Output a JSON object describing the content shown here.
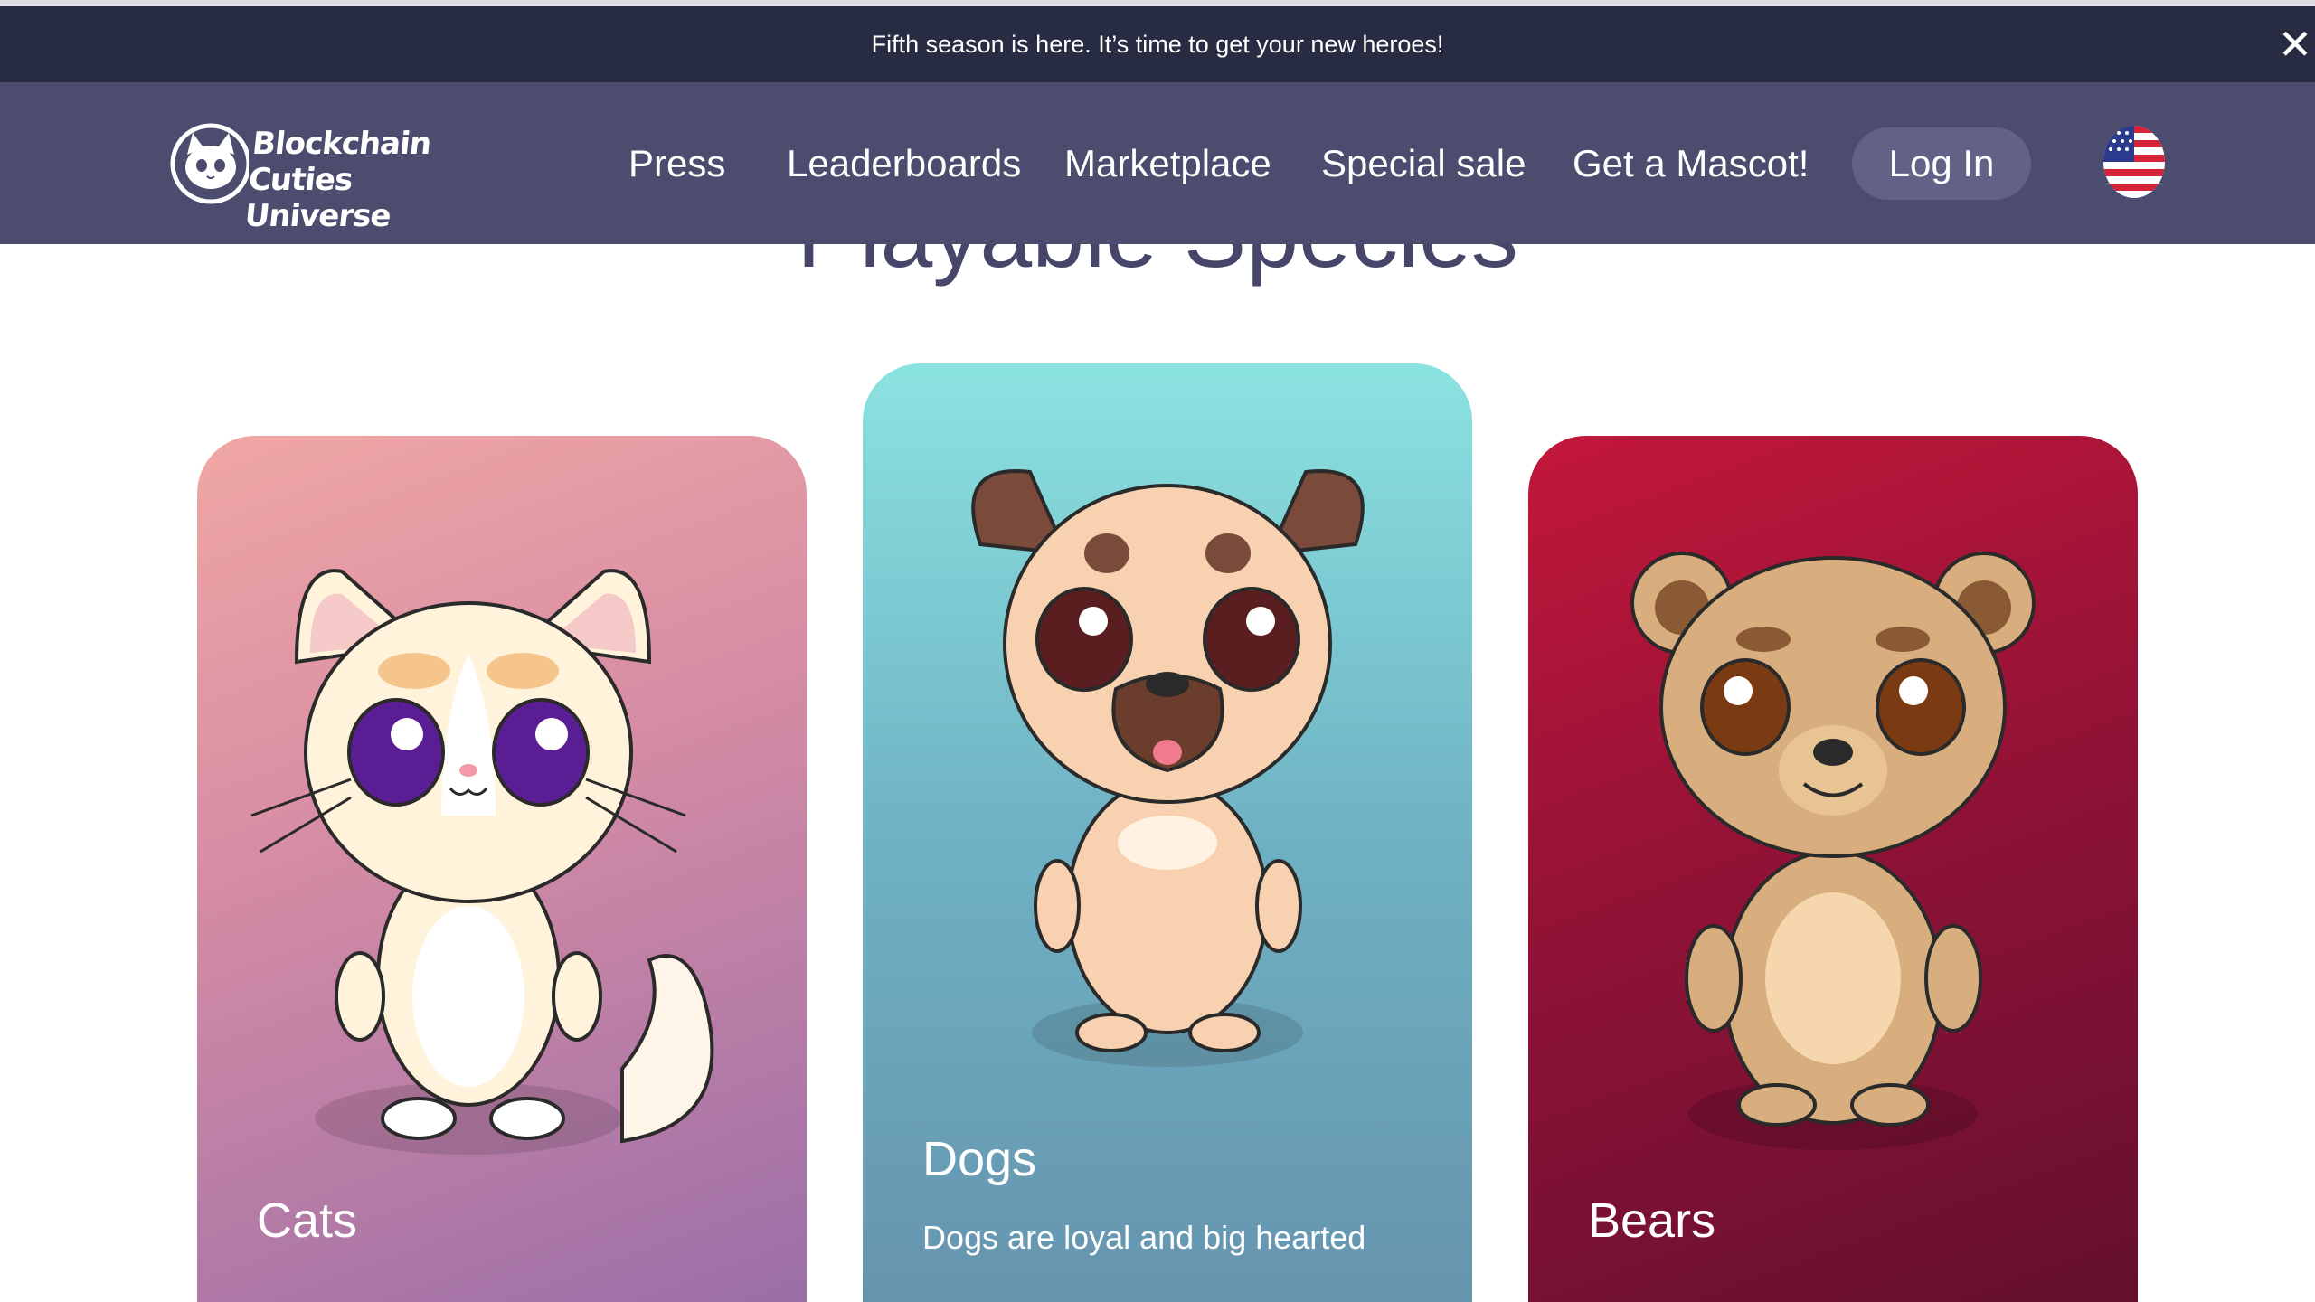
{
  "announcement": {
    "text": "Fifth season is here. It’s time to get your new heroes!",
    "close_glyph": "✕"
  },
  "header": {
    "logo": {
      "line1": "Blockchain",
      "line2": "Cuties Universe",
      "icon": "cat-face-icon"
    },
    "nav": [
      {
        "label": "Press"
      },
      {
        "label": "Leaderboards"
      },
      {
        "label": "Marketplace"
      },
      {
        "label": "Special sale"
      },
      {
        "label": "Get a Mascot!"
      }
    ],
    "login_label": "Log In",
    "language_flag": "us-flag-icon"
  },
  "section": {
    "title": "Playable Species"
  },
  "cards": [
    {
      "name": "Cats",
      "description": "",
      "icon": "cat-character-icon"
    },
    {
      "name": "Dogs",
      "description": "Dogs are loyal and big hearted",
      "icon": "dog-character-icon"
    },
    {
      "name": "Bears",
      "description": "",
      "icon": "bear-character-icon"
    }
  ],
  "colors": {
    "announcement_bg": "#282c43",
    "header_bg": "#4c4c6e",
    "login_bg": "#626186",
    "title_text": "#46466a",
    "cats_gradient": [
      "#f0a7a4",
      "#9b6ea8"
    ],
    "dogs_gradient": [
      "#8be3e0",
      "#6694ae"
    ],
    "bears_gradient": [
      "#c3173a",
      "#64102f"
    ]
  }
}
